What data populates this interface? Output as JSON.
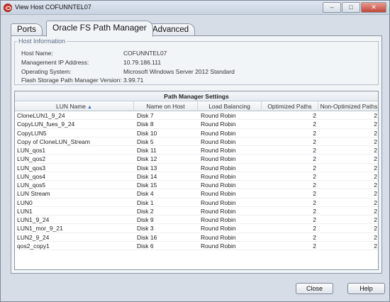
{
  "window": {
    "title": "View Host COFUNNTEL07"
  },
  "tabs": [
    {
      "label": "Ports"
    },
    {
      "label": "Oracle FS Path Manager"
    },
    {
      "label": "Advanced"
    }
  ],
  "host_info": {
    "legend": "Host Information",
    "rows": [
      {
        "label": "Host Name:",
        "value": "COFUNNTEL07"
      },
      {
        "label": "Management IP Address:",
        "value": "10.79.186.111"
      },
      {
        "label": "Operating System:",
        "value": "Microsoft Windows Server 2012 Standard"
      },
      {
        "label": "Flash Storage Path Manager Version:",
        "value": "3.99.71"
      }
    ]
  },
  "table": {
    "title": "Path Manager Settings",
    "columns": [
      "LUN Name",
      "Name on Host",
      "Load Balancing",
      "Optimized Paths",
      "Non-Optimized Paths"
    ],
    "rows": [
      [
        "CloneLUN1_9_24",
        "Disk 7",
        "Round Robin",
        "2",
        "2"
      ],
      [
        "CopyLUN_fues_9_24",
        "Disk 8",
        "Round Robin",
        "2",
        "2"
      ],
      [
        "CopyLUN5",
        "Disk 10",
        "Round Robin",
        "2",
        "2"
      ],
      [
        "Copy of CloneLUN_Stream",
        "Disk 5",
        "Round Robin",
        "2",
        "2"
      ],
      [
        "LUN_qos1",
        "Disk 11",
        "Round Robin",
        "2",
        "2"
      ],
      [
        "LUN_qos2",
        "Disk 12",
        "Round Robin",
        "2",
        "2"
      ],
      [
        "LUN_qos3",
        "Disk 13",
        "Round Robin",
        "2",
        "2"
      ],
      [
        "LUN_qos4",
        "Disk 14",
        "Round Robin",
        "2",
        "2"
      ],
      [
        "LUN_qos5",
        "Disk 15",
        "Round Robin",
        "2",
        "2"
      ],
      [
        "LUN Stream",
        "Disk 4",
        "Round Robin",
        "2",
        "2"
      ],
      [
        "LUN0",
        "Disk 1",
        "Round Robin",
        "2",
        "2"
      ],
      [
        "LUN1",
        "Disk 2",
        "Round Robin",
        "2",
        "2"
      ],
      [
        "LUN1_9_24",
        "Disk 9",
        "Round Robin",
        "2",
        "2"
      ],
      [
        "LUN1_mor_9_21",
        "Disk 3",
        "Round Robin",
        "2",
        "2"
      ],
      [
        "LUN2_9_24",
        "Disk 16",
        "Round Robin",
        "2",
        "2"
      ],
      [
        "qos2_copy1",
        "Disk 6",
        "Round Robin",
        "2",
        "2"
      ]
    ]
  },
  "buttons": {
    "close": "Close",
    "help": "Help"
  }
}
